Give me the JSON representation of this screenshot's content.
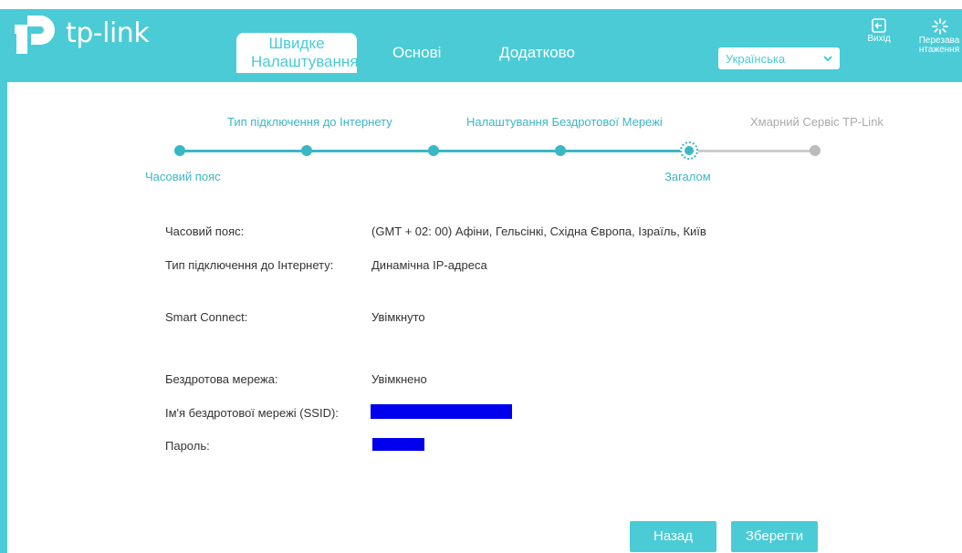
{
  "brand": {
    "logo_text": "tp-link",
    "accent": "#4acbd6"
  },
  "nav": {
    "tabs": [
      {
        "label": "Швидке Налаштування",
        "active": true
      },
      {
        "label": "Основі",
        "active": false
      },
      {
        "label": "Додатково",
        "active": false
      }
    ]
  },
  "language": {
    "selected": "Українська",
    "icon": "chevron-down-icon"
  },
  "top_actions": {
    "logout": {
      "label": "Вихід",
      "icon": "logout-icon"
    },
    "reboot": {
      "label": "Перезава нтаження",
      "icon": "reboot-icon"
    }
  },
  "wizard": {
    "steps": [
      {
        "label": "Часовий пояс",
        "state": "done"
      },
      {
        "label": "Тип підключення до Інтернету",
        "state": "done"
      },
      {
        "label": "",
        "state": "done"
      },
      {
        "label": "Налаштування Бездротової Мережі",
        "state": "done"
      },
      {
        "label": "Загалом",
        "state": "current"
      },
      {
        "label": "Хмарний Сервіс TP-Link",
        "state": "todo"
      }
    ]
  },
  "summary": {
    "timezone": {
      "label": "Часовий пояс:",
      "value": "(GMT + 02: 00) Афіни, Гельсінкі, Східна Європа, Ізраїль, Київ"
    },
    "connection": {
      "label": "Тип підключення до Інтернету:",
      "value": "Динамічна IP-адреса"
    },
    "smart_connect": {
      "label": "Smart Connect:",
      "value": "Увімкнуто"
    },
    "wireless": {
      "label": "Бездротова мережа:",
      "value": "Увімкнено"
    },
    "ssid": {
      "label": "Ім'я бездротової мережі (SSID):",
      "value": ""
    },
    "password": {
      "label": "Пароль:",
      "value": ""
    }
  },
  "buttons": {
    "back": "Назад",
    "save": "Зберегти"
  }
}
